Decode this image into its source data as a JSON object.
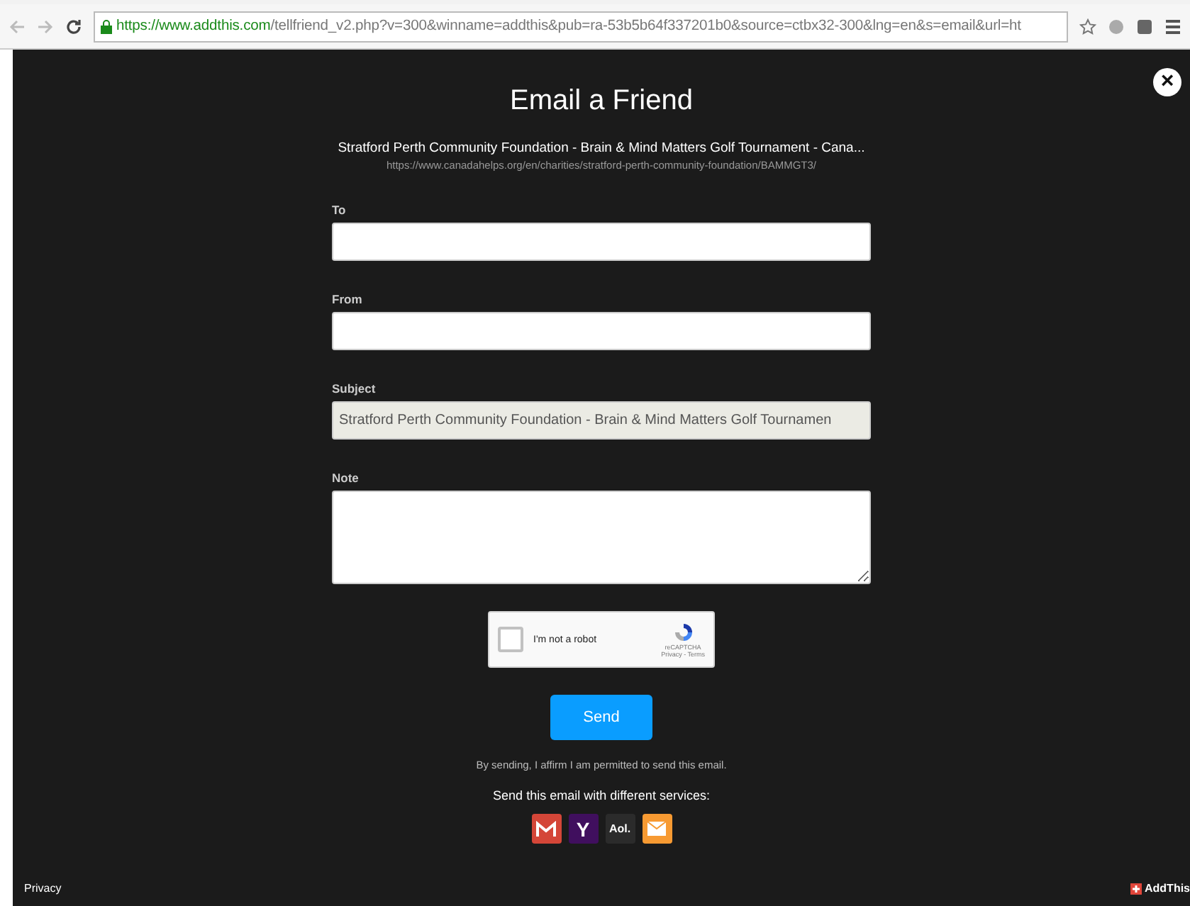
{
  "browser": {
    "url_host": "https://www.addthis.com",
    "url_path": "/tellfriend_v2.php?v=300&winname=addthis&pub=ra-53b5b64f337201b0&source=ctbx32-300&lng=en&s=email&url=ht"
  },
  "dialog": {
    "title": "Email a Friend",
    "close": "×",
    "page_title": "Stratford Perth Community Foundation - Brain & Mind Matters Golf Tournament - Cana...",
    "page_url": "https://www.canadahelps.org/en/charities/stratford-perth-community-foundation/BAMMGT3/",
    "fields": [
      {
        "label": "To",
        "kind": "input"
      },
      {
        "label": "From",
        "kind": "input"
      },
      {
        "label": "Subject",
        "kind": "input",
        "value": "Stratford Perth Community Foundation - Brain & Mind Matters Golf Tournamen",
        "disabled": true
      },
      {
        "label": "Note",
        "kind": "textarea"
      }
    ],
    "captcha": {
      "label": "I'm not a robot",
      "checked": false,
      "brand": "reCAPTCHA",
      "links": "Privacy - Terms"
    },
    "send": "Send",
    "affirm": "By sending, I affirm I am permitted to send this email.",
    "services_title": "Send this email with different services:",
    "services": [
      {
        "kind": "gmail",
        "color": "#d44638"
      },
      {
        "kind": "yahoo",
        "text": "Y",
        "color": "#400f5e"
      },
      {
        "kind": "aol",
        "text": "Aol.",
        "color": "#2b2b2b"
      },
      {
        "kind": "mail",
        "color": "#f79a32"
      }
    ]
  },
  "footer": {
    "privacy": "Privacy",
    "brand": "AddThis"
  }
}
